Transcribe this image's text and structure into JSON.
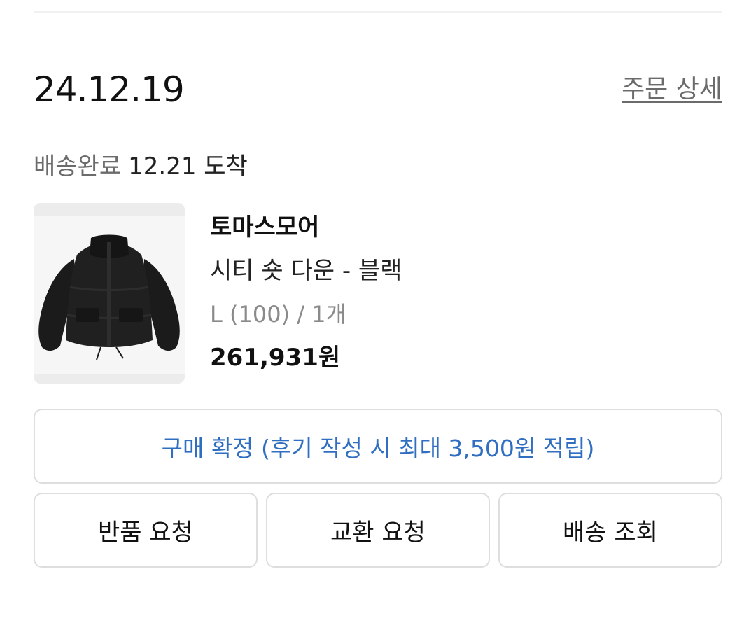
{
  "order": {
    "date": "24.12.19",
    "detail_link": "주문 상세"
  },
  "delivery": {
    "status": "배송완료",
    "arrival": "12.21 도착"
  },
  "product": {
    "brand": "토마스모어",
    "name": "시티 숏 다운 - 블랙",
    "option": "L (100) / 1개",
    "price": "261,931원",
    "image_icon": "black-down-jacket-image"
  },
  "actions": {
    "confirm_label": "구매 확정 (후기 작성 시 최대 3,500원 적립)",
    "return_label": "반품 요청",
    "exchange_label": "교환 요청",
    "tracking_label": "배송 조회"
  },
  "colors": {
    "accent_blue": "#2f6ec0",
    "muted_gray": "#6b6b6b",
    "border": "#dedede"
  }
}
